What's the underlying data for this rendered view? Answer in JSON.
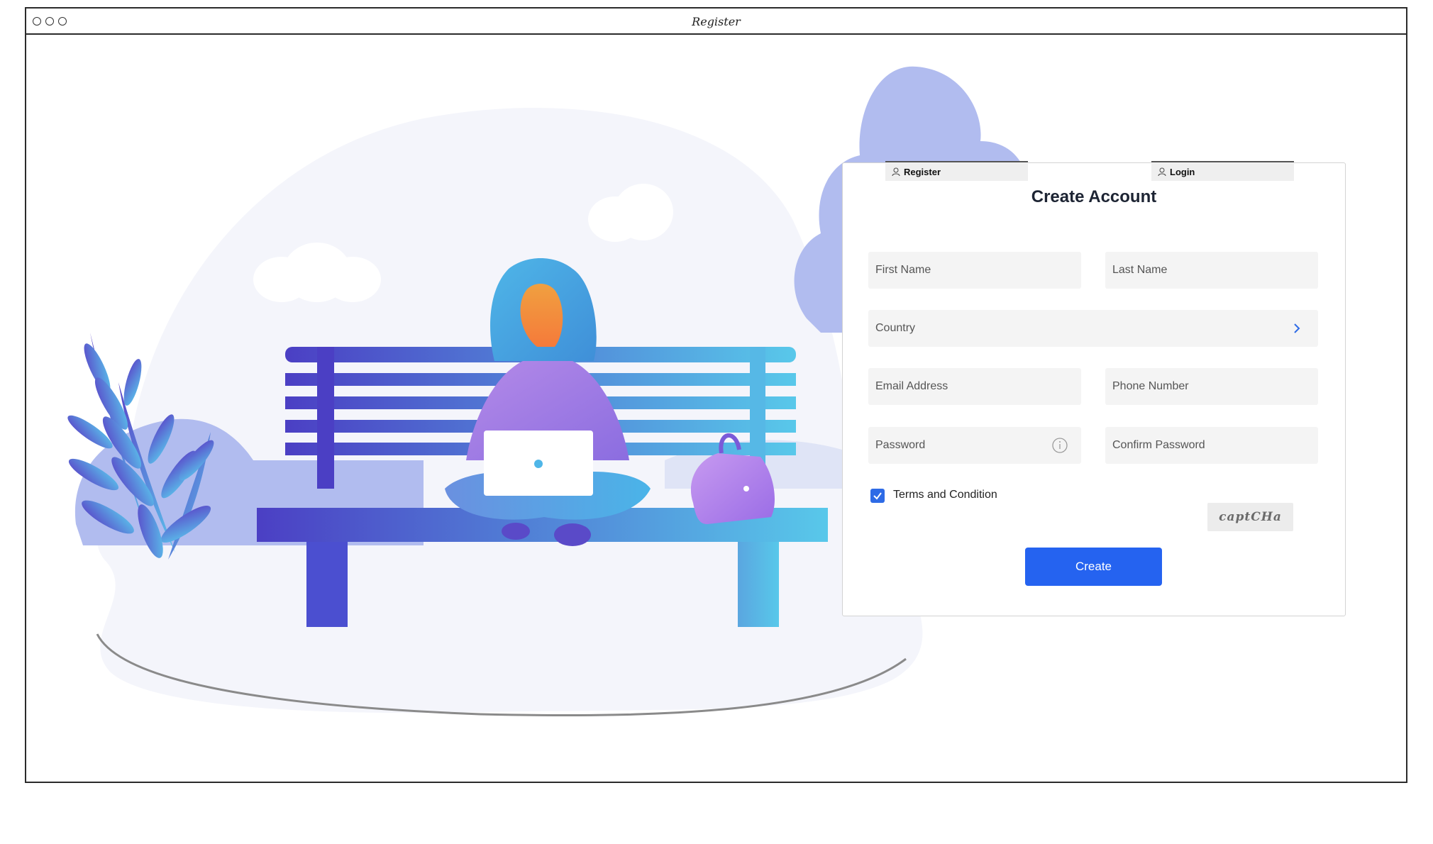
{
  "window": {
    "title": "Register"
  },
  "tabs": {
    "register": "Register",
    "login": "Login"
  },
  "form": {
    "title": "Create Account",
    "first_name_placeholder": "First Name",
    "last_name_placeholder": "Last Name",
    "country_placeholder": "Country",
    "email_placeholder": "Email Address",
    "phone_placeholder": "Phone Number",
    "password_placeholder": "Password",
    "confirm_password_placeholder": "Confirm Password",
    "terms_label": "Terms and Condition",
    "terms_checked": true,
    "captcha_text": "captCHa",
    "create_label": "Create"
  },
  "icons": {
    "country": "chevron-right-icon",
    "password": "info-icon",
    "tabs": "user-icon"
  },
  "colors": {
    "accent": "#2563f0",
    "checkbox": "#2e6be6",
    "field_bg": "#f4f4f4"
  }
}
